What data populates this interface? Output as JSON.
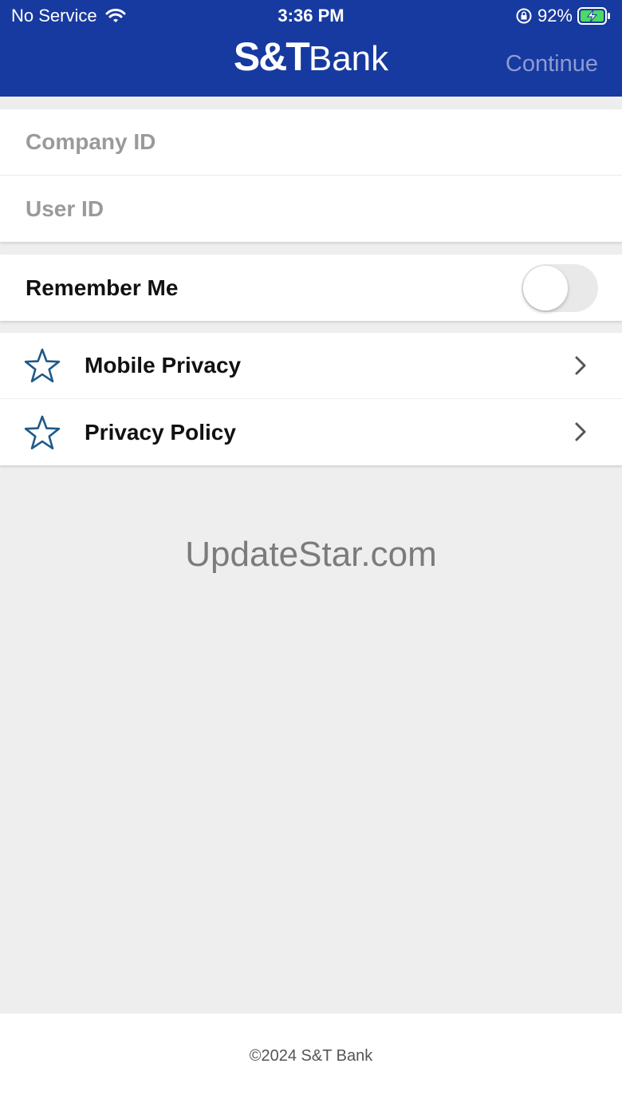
{
  "status_bar": {
    "carrier": "No Service",
    "time": "3:36 PM",
    "battery": "92%"
  },
  "header": {
    "logo_primary": "S&T",
    "logo_secondary": "Bank",
    "continue_label": "Continue"
  },
  "login": {
    "company_id_placeholder": "Company ID",
    "user_id_placeholder": "User ID"
  },
  "remember_me": {
    "label": "Remember Me",
    "enabled": false
  },
  "menu": {
    "items": [
      {
        "label": "Mobile Privacy",
        "icon": "star-outline-icon"
      },
      {
        "label": "Privacy Policy",
        "icon": "star-outline-icon"
      }
    ]
  },
  "watermark": "UpdateStar.com",
  "footer": {
    "copyright": "©2024 S&T Bank"
  },
  "colors": {
    "header_bg": "#173aa0",
    "continue_text": "#8e9bd0",
    "star_icon": "#1f5a8a",
    "page_bg": "#eeeeee"
  }
}
